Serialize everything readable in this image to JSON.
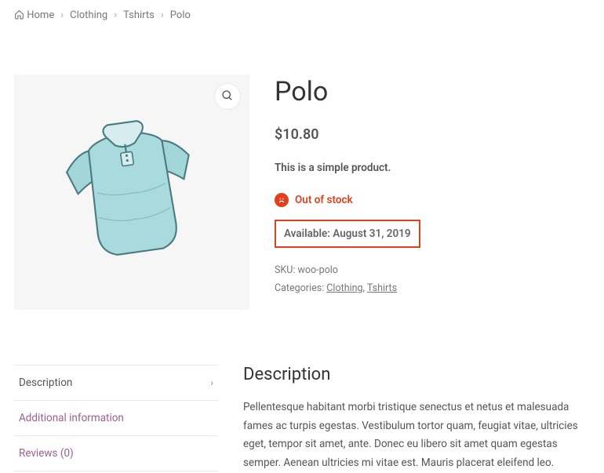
{
  "breadcrumb": {
    "home": "Home",
    "items": [
      "Clothing",
      "Tshirts"
    ],
    "current": "Polo"
  },
  "product": {
    "title": "Polo",
    "currency": "$",
    "price": "10.80",
    "short_description": "This is a simple product.",
    "stock_status": "Out of stock",
    "availability_label": "Available:",
    "availability_date": "August 31, 2019",
    "sku_label": "SKU:",
    "sku": "woo-polo",
    "categories_label": "Categories:",
    "categories": [
      "Clothing",
      "Tshirts"
    ]
  },
  "tabs": {
    "items": [
      {
        "label": "Description",
        "active": true
      },
      {
        "label": "Additional information",
        "active": false
      },
      {
        "label": "Reviews (0)",
        "active": false
      }
    ],
    "panel_heading": "Description",
    "panel_body": "Pellentesque habitant morbi tristique senectus et netus et malesuada fames ac turpis egestas. Vestibulum tortor quam, feugiat vitae, ultricies eget, tempor sit amet, ante. Donec eu libero sit amet quam egestas semper. Aenean ultricies mi vitae est. Mauris placerat eleifend leo."
  }
}
